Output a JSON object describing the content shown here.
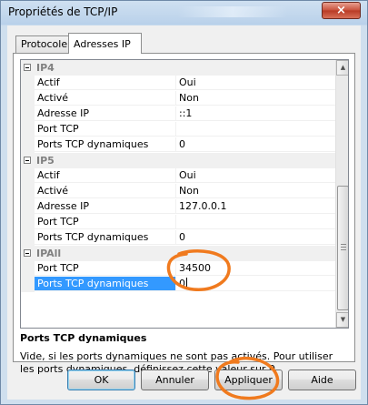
{
  "window": {
    "title": "Propriétés de TCP/IP",
    "close_icon": "×"
  },
  "tabs": [
    {
      "label": "Protocole",
      "active": false
    },
    {
      "label": "Adresses IP",
      "active": true
    }
  ],
  "grid": {
    "categories": [
      {
        "label": "IP4",
        "rows": [
          {
            "name": "Actif",
            "value": "Oui"
          },
          {
            "name": "Activé",
            "value": "Non"
          },
          {
            "name": "Adresse IP",
            "value": "::1"
          },
          {
            "name": "Port TCP",
            "value": ""
          },
          {
            "name": "Ports TCP dynamiques",
            "value": "0"
          }
        ]
      },
      {
        "label": "IP5",
        "rows": [
          {
            "name": "Actif",
            "value": "Oui"
          },
          {
            "name": "Activé",
            "value": "Non"
          },
          {
            "name": "Adresse IP",
            "value": "127.0.0.1"
          },
          {
            "name": "Port TCP",
            "value": ""
          },
          {
            "name": "Ports TCP dynamiques",
            "value": "0"
          }
        ]
      },
      {
        "label": "IPAll",
        "rows": [
          {
            "name": "Port TCP",
            "value": "34500"
          },
          {
            "name": "Ports TCP dynamiques",
            "value": "0",
            "selected": true
          }
        ]
      }
    ]
  },
  "description": {
    "title": "Ports TCP dynamiques",
    "text": "Vide, si les ports dynamiques ne sont pas activés. Pour utiliser les ports dynamiques, définissez cette valeur sur 0."
  },
  "buttons": {
    "ok": "OK",
    "cancel": "Annuler",
    "apply": "Appliquer",
    "help": "Aide"
  },
  "colors": {
    "annotation": "#f07a1e",
    "selection": "#3399ff"
  }
}
